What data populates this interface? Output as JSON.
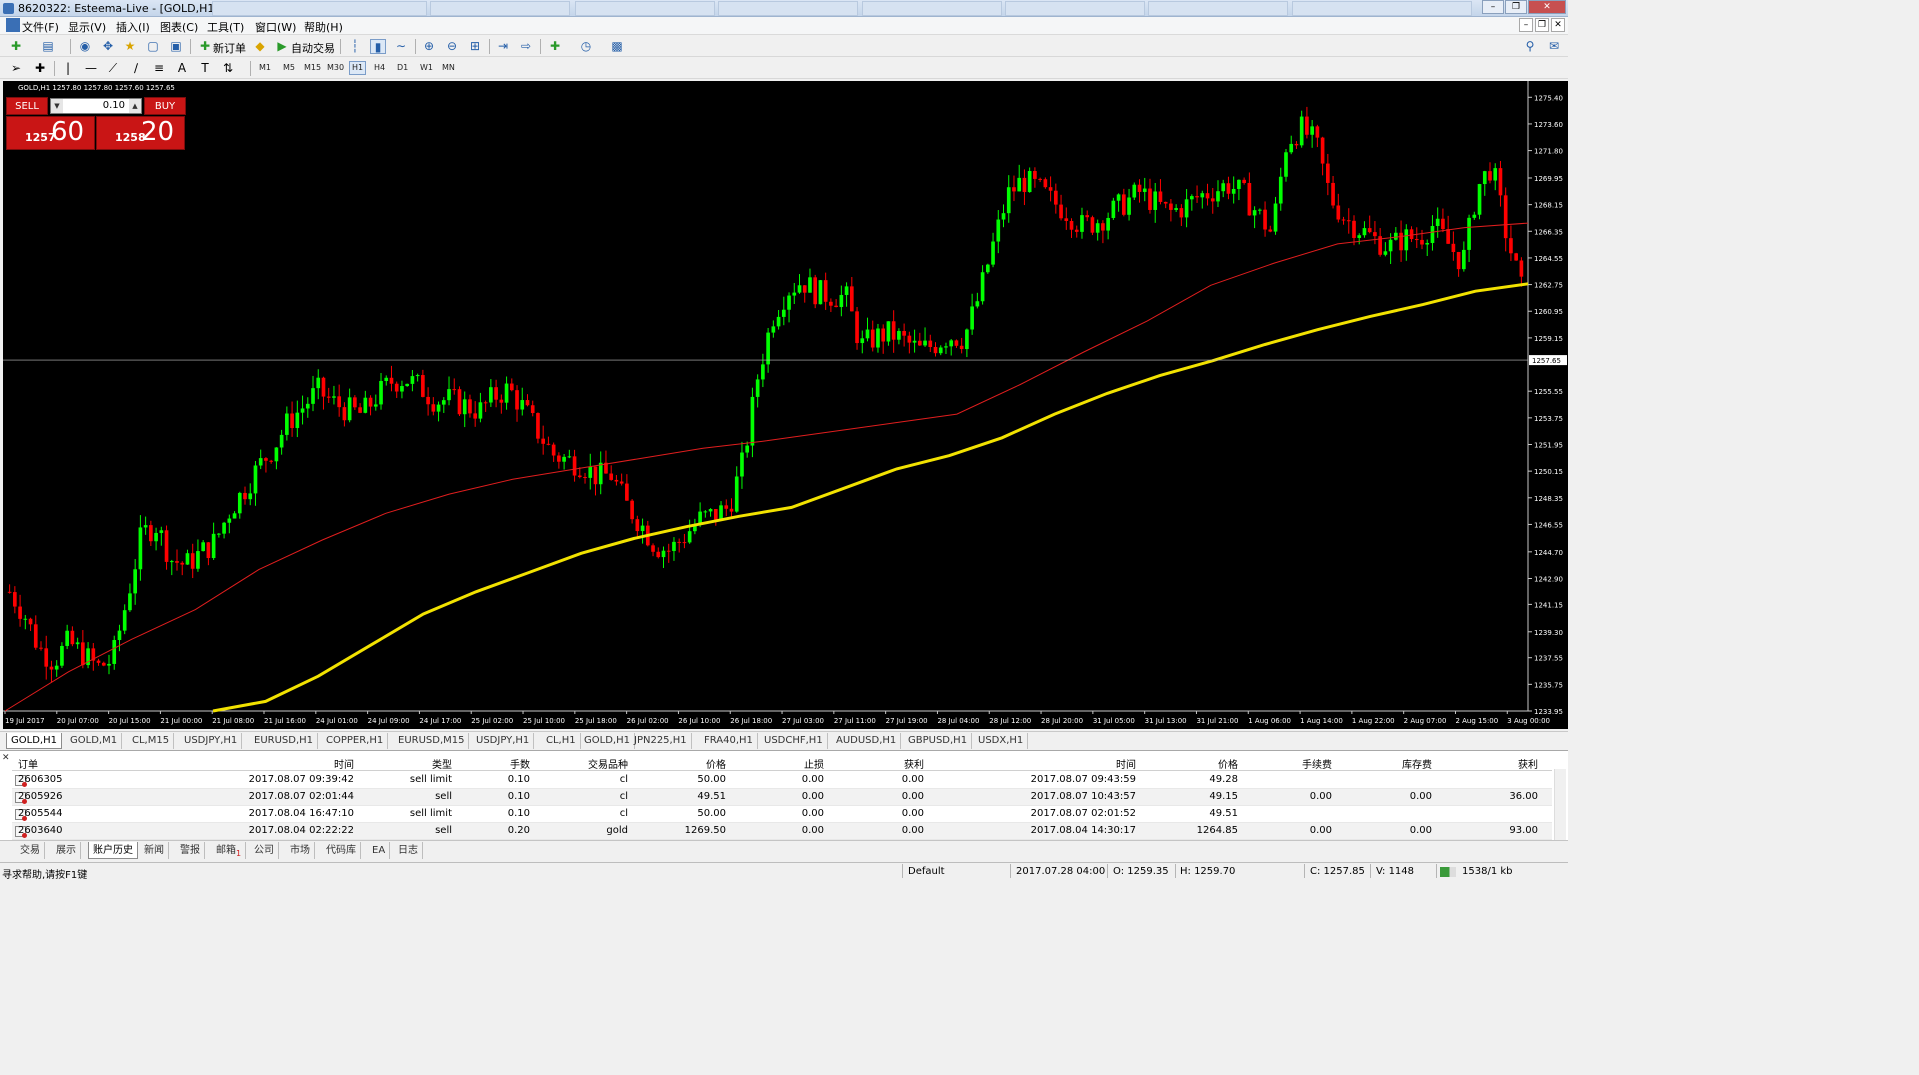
{
  "window": {
    "title": "8620322: Esteema-Live - [GOLD,H1]",
    "buttons": [
      "minimize",
      "restore",
      "close"
    ]
  },
  "menu": {
    "items": [
      "文件(F)",
      "显示(V)",
      "插入(I)",
      "图表(C)",
      "工具(T)",
      "窗口(W)",
      "帮助(H)"
    ]
  },
  "toolbar": {
    "new_order": "新订单",
    "auto_trading": "自动交易",
    "timeframes": [
      "M1",
      "M5",
      "M15",
      "M30",
      "H1",
      "H4",
      "D1",
      "W1",
      "MN"
    ],
    "active_timeframe": "H1"
  },
  "one_click": {
    "sell_label": "SELL",
    "buy_label": "BUY",
    "lots": "0.10",
    "sell_prefix": "1257",
    "sell_big": "60",
    "buy_prefix": "1258",
    "buy_big": "20"
  },
  "chart_data": {
    "type": "candlestick",
    "symbol_info": "GOLD,H1  1257.80 1257.80 1257.60 1257.65",
    "current_price": 1257.65,
    "ylim": [
      1233.95,
      1276.5
    ],
    "y_ticks": [
      "1275.40",
      "1273.60",
      "1271.80",
      "1269.95",
      "1268.15",
      "1266.35",
      "1264.55",
      "1262.75",
      "1260.95",
      "1259.15",
      "1255.55",
      "1253.75",
      "1251.95",
      "1250.15",
      "1248.35",
      "1246.55",
      "1244.70",
      "1242.90",
      "1241.15",
      "1239.30",
      "1237.55",
      "1235.75",
      "1233.95"
    ],
    "x_ticks": [
      "19 Jul 2017",
      "20 Jul 07:00",
      "20 Jul 15:00",
      "21 Jul 00:00",
      "21 Jul 08:00",
      "21 Jul 16:00",
      "24 Jul 01:00",
      "24 Jul 09:00",
      "24 Jul 17:00",
      "25 Jul 02:00",
      "25 Jul 10:00",
      "25 Jul 18:00",
      "26 Jul 02:00",
      "26 Jul 10:00",
      "26 Jul 18:00",
      "27 Jul 03:00",
      "27 Jul 11:00",
      "27 Jul 19:00",
      "28 Jul 04:00",
      "28 Jul 12:00",
      "28 Jul 20:00",
      "31 Jul 05:00",
      "31 Jul 13:00",
      "31 Jul 21:00",
      "1 Aug 06:00",
      "1 Aug 14:00",
      "1 Aug 22:00",
      "2 Aug 07:00",
      "2 Aug 15:00",
      "3 Aug 00:00"
    ],
    "close_path": [
      1242.0,
      1240.5,
      1238.2,
      1237.3,
      1238.6,
      1237.8,
      1236.9,
      1237.4,
      1241.5,
      1245.9,
      1246.5,
      1244.2,
      1243.8,
      1244.6,
      1245.4,
      1247.5,
      1248.9,
      1250.5,
      1251.8,
      1253.5,
      1254.5,
      1255.6,
      1254.8,
      1254.3,
      1254.0,
      1255.2,
      1256.2,
      1256.4,
      1255.8,
      1254.9,
      1255.0,
      1254.6,
      1254.2,
      1255.2,
      1255.7,
      1254.4,
      1252.8,
      1251.3,
      1250.9,
      1250.6,
      1249.8,
      1249.9,
      1247.9,
      1246.6,
      1245.1,
      1244.8,
      1245.8,
      1246.9,
      1247.2,
      1247.7,
      1250.9,
      1256.7,
      1260.6,
      1262.4,
      1263.0,
      1262.2,
      1262.0,
      1261.9,
      1258.6,
      1259.2,
      1259.5,
      1258.9,
      1258.3,
      1258.7,
      1259.3,
      1259.1,
      1261.8,
      1265.4,
      1268.8,
      1269.8,
      1269.3,
      1268.4,
      1267.7,
      1266.7,
      1267.0,
      1267.6,
      1268.3,
      1269.0,
      1268.3,
      1267.6,
      1268.0,
      1268.7,
      1269.1,
      1269.5,
      1268.9,
      1267.6,
      1266.2,
      1272.4,
      1273.3,
      1272.3,
      1268.6,
      1267.2,
      1266.5,
      1265.8,
      1265.3,
      1265.9,
      1265.9,
      1266.8,
      1265.5,
      1264.2,
      1269.3,
      1270.8,
      1266.0,
      1262.5
    ],
    "candle_count": 290,
    "series": [
      {
        "name": "MA (red)",
        "color": "#e01e1e",
        "values": [
          1233.95,
          1236.6,
          1238.8,
          1240.8,
          1243.5,
          1245.5,
          1247.3,
          1248.6,
          1249.6,
          1250.3,
          1251.0,
          1251.7,
          1252.2,
          1252.8,
          1253.4,
          1254.0,
          1256.0,
          1258.2,
          1260.3,
          1262.7,
          1264.2,
          1265.5,
          1266.0,
          1266.6,
          1266.9
        ]
      },
      {
        "name": "MA (yellow)",
        "color": "#f2e200",
        "values": [
          1233.95,
          1234.6,
          1236.3,
          1238.4,
          1240.5,
          1242.0,
          1243.3,
          1244.6,
          1245.6,
          1246.4,
          1247.1,
          1247.7,
          1249.0,
          1250.3,
          1251.2,
          1252.4,
          1254.0,
          1255.4,
          1256.6,
          1257.6,
          1258.7,
          1259.7,
          1260.6,
          1261.4,
          1262.3,
          1262.8
        ]
      }
    ],
    "colors": {
      "bull": "#00ff00",
      "bear": "#ff0000",
      "background": "#000000",
      "axis_text": "#ffffff",
      "bid_line": "#c0c0c0"
    }
  },
  "chart_tabs": [
    "GOLD,H1",
    "GOLD,M1",
    "CL,M15",
    "USDJPY,H1",
    "EURUSD,H1",
    "COPPER,H1",
    "EURUSD,M15",
    "USDJPY,H1",
    "CL,H1",
    "GOLD,H1",
    "JPN225,H1",
    "FRA40,H1",
    "USDCHF,H1",
    "AUDUSD,H1",
    "GBPUSD,H1",
    "USDX,H1"
  ],
  "terminal": {
    "columns": [
      "订单",
      "时间",
      "类型",
      "手数",
      "交易品种",
      "价格",
      "止损",
      "获利",
      "时间",
      "价格",
      "手续费",
      "库存费",
      "获利"
    ],
    "rows": [
      [
        "2606305",
        "2017.08.07 09:39:42",
        "sell limit",
        "0.10",
        "cl",
        "50.00",
        "0.00",
        "0.00",
        "2017.08.07 09:43:59",
        "49.28",
        "",
        "",
        ""
      ],
      [
        "2605926",
        "2017.08.07 02:01:44",
        "sell",
        "0.10",
        "cl",
        "49.51",
        "0.00",
        "0.00",
        "2017.08.07 10:43:57",
        "49.15",
        "0.00",
        "0.00",
        "36.00"
      ],
      [
        "2605544",
        "2017.08.04 16:47:10",
        "sell limit",
        "0.10",
        "cl",
        "50.00",
        "0.00",
        "0.00",
        "2017.08.07 02:01:52",
        "49.51",
        "",
        "",
        ""
      ],
      [
        "2603640",
        "2017.08.04 02:22:22",
        "sell",
        "0.20",
        "gold",
        "1269.50",
        "0.00",
        "0.00",
        "2017.08.04 14:30:17",
        "1264.85",
        "0.00",
        "0.00",
        "93.00"
      ]
    ]
  },
  "terminal_tabs": [
    "交易",
    "展示",
    "账户历史",
    "新闻",
    "警报",
    "邮箱",
    "公司",
    "市场",
    "代码库",
    "EA",
    "日志"
  ],
  "terminal_active_tab": "账户历史",
  "mail_badge": "1",
  "status": {
    "help": "寻求帮助,请按F1键",
    "profile": "Default",
    "datetime": "2017.07.28 04:00",
    "open": "O: 1259.35",
    "high": "H: 1259.70",
    "close": "C: 1257.85",
    "volume": "V: 1148",
    "traffic": "1538/1 kb"
  }
}
